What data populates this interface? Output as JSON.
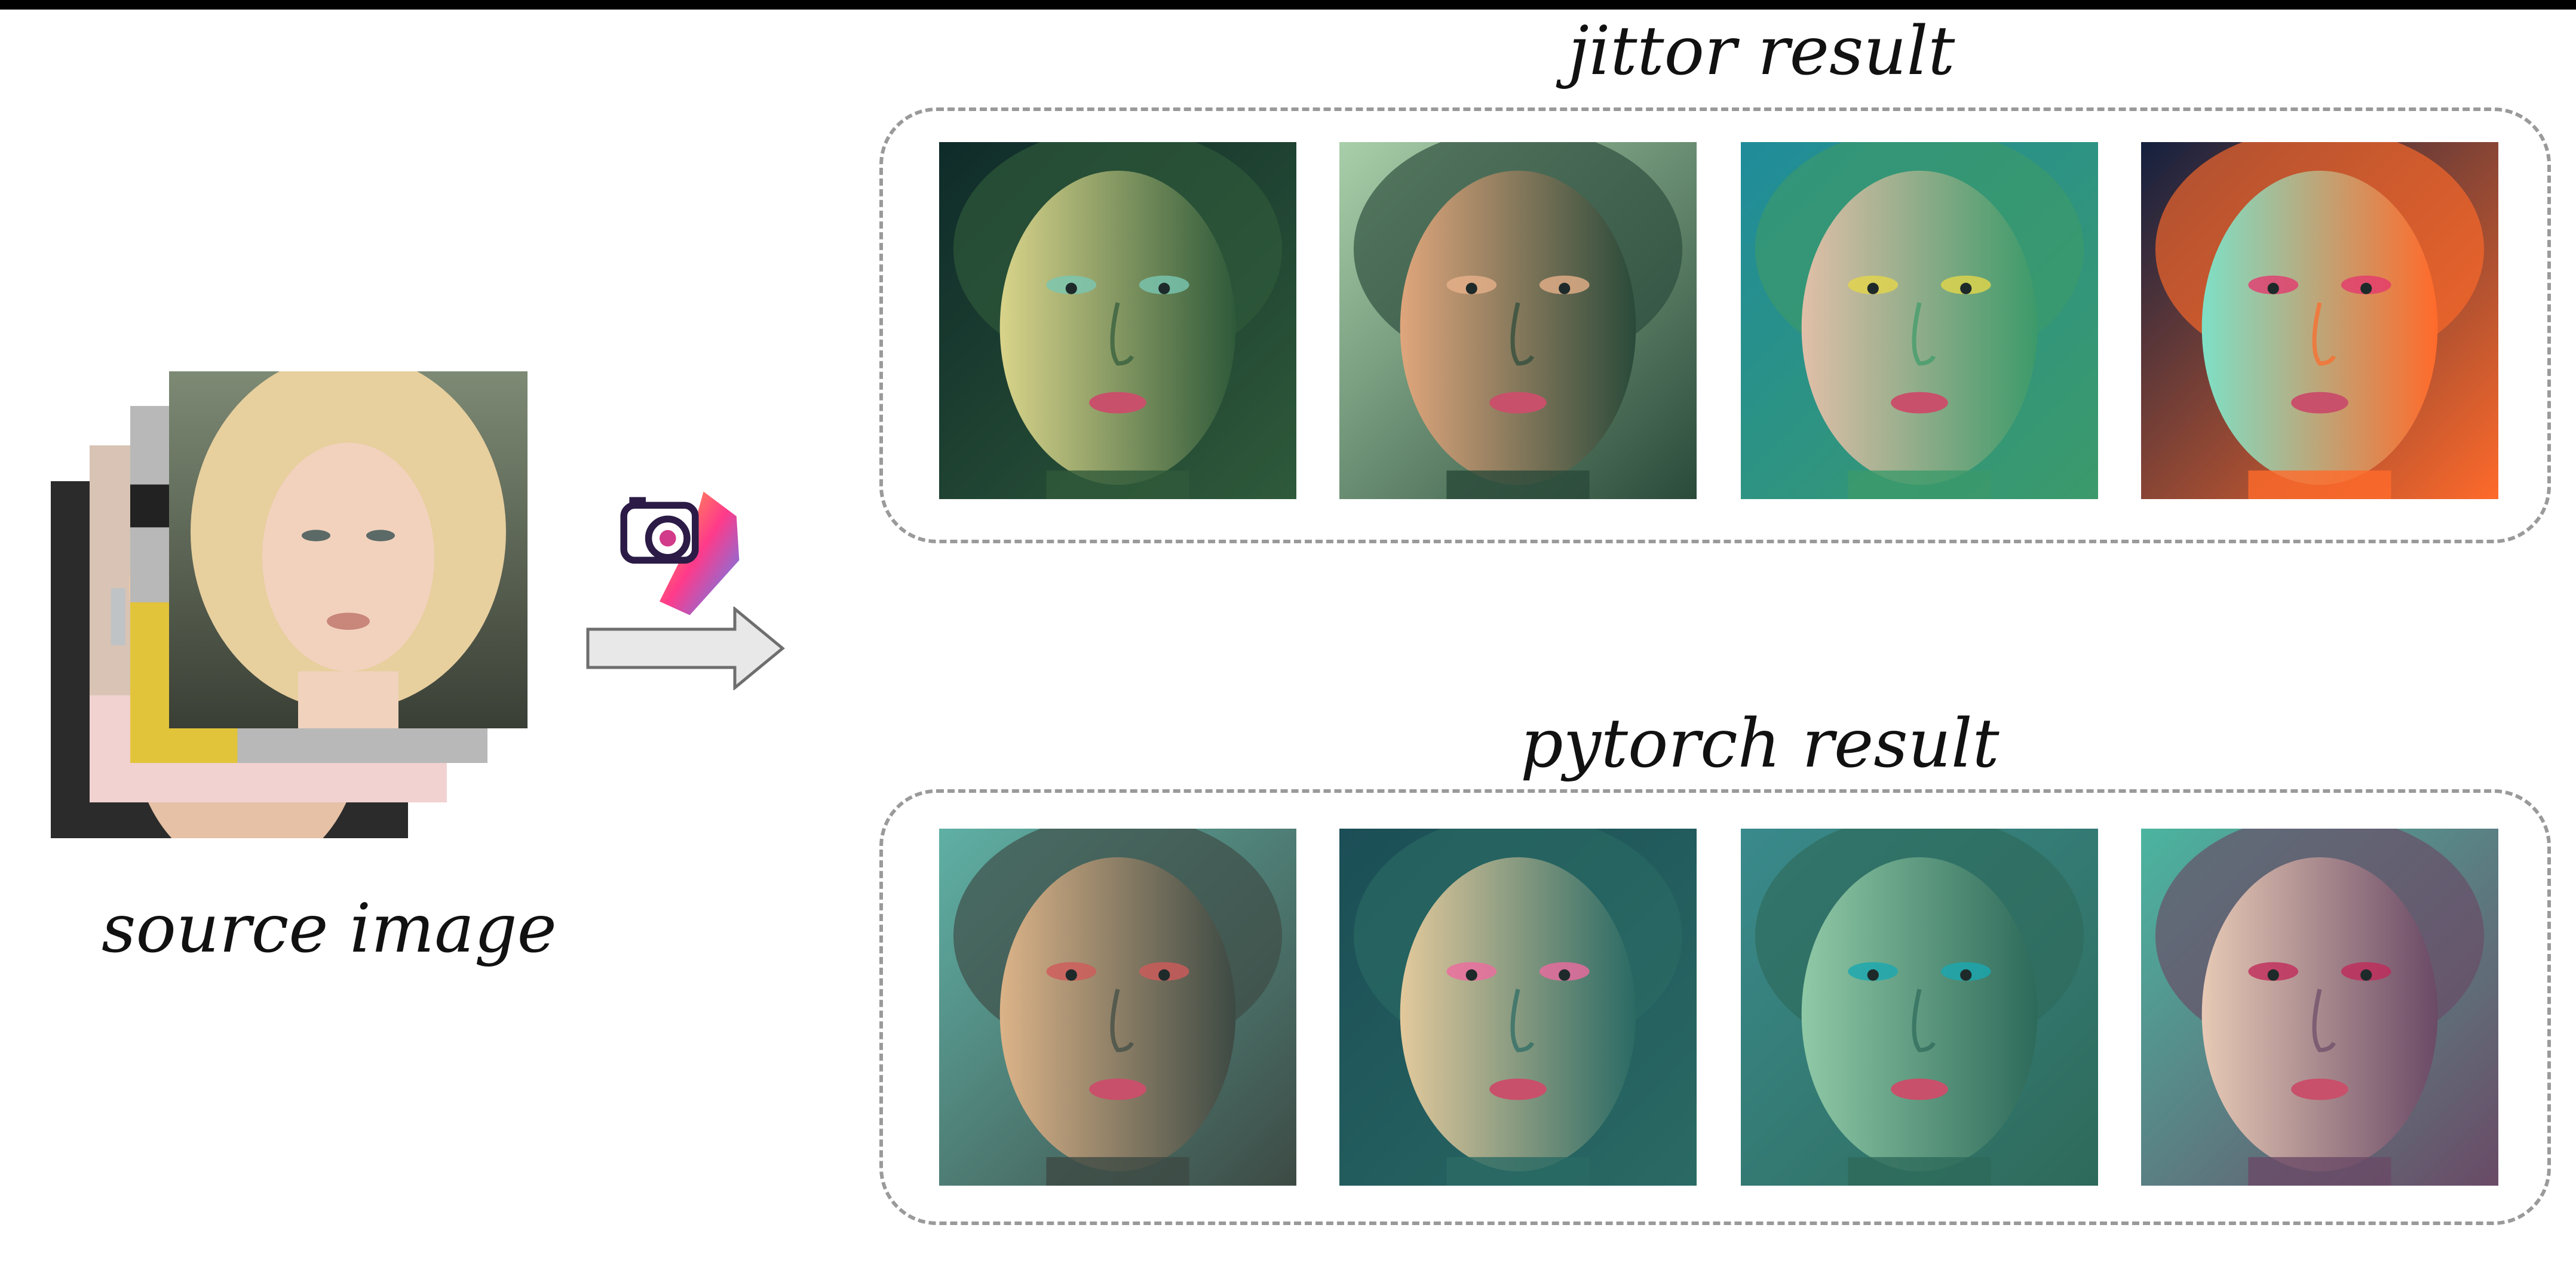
{
  "labels": {
    "source": "source image",
    "jittor": "jittor result",
    "pytorch": "pytorch result"
  },
  "icons": {
    "logo": "camera-logo-icon",
    "arrow": "right-arrow-icon"
  },
  "jittor_results": [
    {
      "name": "jittor-result-1",
      "bg": "#0f2b2a",
      "skin": "#d9d48a",
      "shade": "#2f5a3a",
      "accent": "#79c7b3"
    },
    {
      "name": "jittor-result-2",
      "bg": "#a8cfa9",
      "skin": "#e0a67c",
      "shade": "#2a4a3a",
      "accent": "#e6b08a"
    },
    {
      "name": "jittor-result-3",
      "bg": "#1f8c9a",
      "skin": "#e1bfa8",
      "shade": "#3c9a6a",
      "accent": "#e3d64a"
    },
    {
      "name": "jittor-result-4",
      "bg": "#13203f",
      "skin": "#7ee0c6",
      "shade": "#ff6a2a",
      "accent": "#e33a6e"
    }
  ],
  "pytorch_results": [
    {
      "name": "pytorch-result-1",
      "bg": "#5fb0a5",
      "skin": "#dcb388",
      "shade": "#3d4a44",
      "accent": "#cf5a5a"
    },
    {
      "name": "pytorch-result-2",
      "bg": "#1b4e56",
      "skin": "#e3c99c",
      "shade": "#2a6a64",
      "accent": "#ee6aa0"
    },
    {
      "name": "pytorch-result-3",
      "bg": "#3a8a8c",
      "skin": "#8fc9a6",
      "shade": "#2e6a5a",
      "accent": "#19a7b0"
    },
    {
      "name": "pytorch-result-4",
      "bg": "#4bb5a0",
      "skin": "#e7c9b5",
      "shade": "#6a4a66",
      "accent": "#c02a5a"
    }
  ],
  "source_stack": [
    {
      "name": "source-card-back",
      "bg": "#2b2b2b"
    },
    {
      "name": "source-card-3",
      "bg": "#f1d2d0"
    },
    {
      "name": "source-card-2",
      "bg": "#b8b8b8"
    },
    {
      "name": "source-card-front",
      "bg": "#55624d"
    }
  ]
}
